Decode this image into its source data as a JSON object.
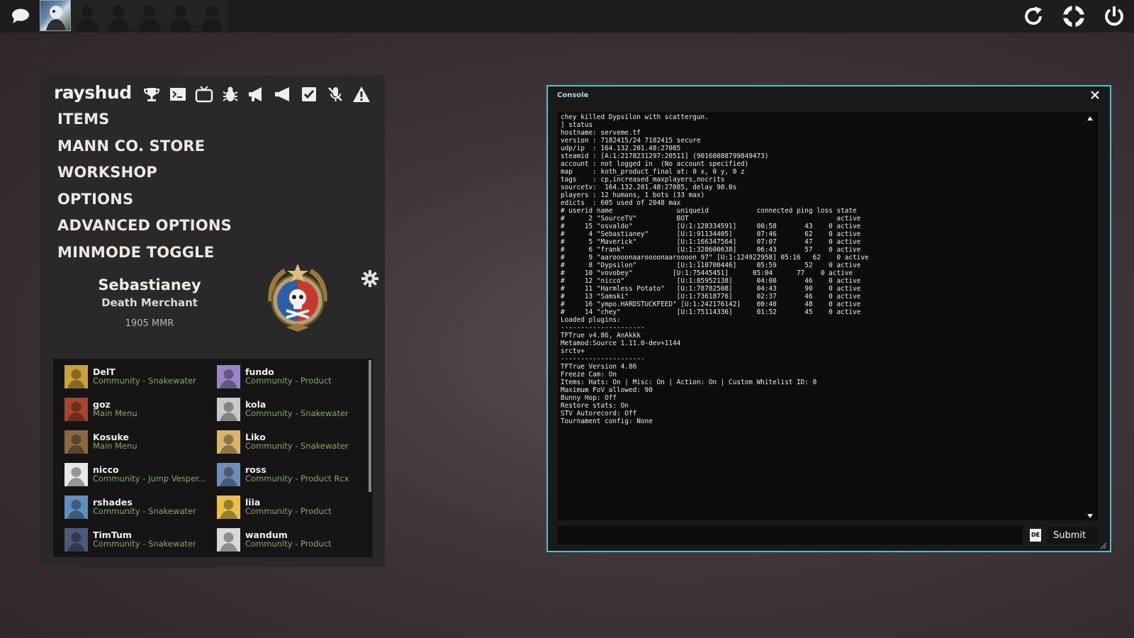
{
  "topbar": {
    "icons": {
      "chat": "chat-bubble-icon",
      "reload": "reload-icon",
      "help": "lifebuoy-icon",
      "power": "power-icon"
    },
    "party_slots": 6
  },
  "menu": {
    "brand": "rayshud",
    "quick_icons": [
      "trophy-icon",
      "terminal-icon",
      "tv-icon",
      "bug-icon",
      "megaphone-icon",
      "megaphone-alt-icon",
      "checkbox-icon",
      "mute-mic-icon",
      "warning-icon"
    ],
    "items": [
      "ITEMS",
      "MANN CO. STORE",
      "WORKSHOP",
      "OPTIONS",
      "ADVANCED OPTIONS",
      "MINMODE TOGGLE"
    ]
  },
  "player": {
    "name": "Sebastianey",
    "title": "Death Merchant",
    "mmr": "1905 MMR"
  },
  "friends": [
    {
      "name": "DelT",
      "status": "Community - Snakewater",
      "avatar_color": "#c9a23a"
    },
    {
      "name": "fundo",
      "status": "Community - Product",
      "avatar_color": "#9a86c4"
    },
    {
      "name": "goz",
      "status": "Main Menu",
      "avatar_color": "#a8462b"
    },
    {
      "name": "kola",
      "status": "Community - Snakewater",
      "avatar_color": "#c9c9c9"
    },
    {
      "name": "Kosuke",
      "status": "Main Menu",
      "avatar_color": "#8a6a45"
    },
    {
      "name": "Liko",
      "status": "Community - Snakewater",
      "avatar_color": "#d7b56a"
    },
    {
      "name": "nicco",
      "status": "Community - Jump Vesper...",
      "avatar_color": "#e8e8e8"
    },
    {
      "name": "ross",
      "status": "Community - Product Rcx",
      "avatar_color": "#6f8eb5"
    },
    {
      "name": "rshades",
      "status": "Community - Snakewater",
      "avatar_color": "#5d8fbf"
    },
    {
      "name": "liia",
      "status": "Community - Product",
      "avatar_color": "#e8c04a"
    },
    {
      "name": "TimTum",
      "status": "Community - Snakewater",
      "avatar_color": "#4a5a7a"
    },
    {
      "name": "wandum",
      "status": "Community - Product",
      "avatar_color": "#d9d9d9"
    }
  ],
  "console": {
    "title": "Console",
    "output": "chey killed Dypsilon with scattergun.\n] status\nhostname: serveme.tf\nversion : 7182415/24 7182415 secure\nudp/ip  : 164.132.201.48:27085\nsteamid : [A:1:2178231297:20511] (90160088799849473)\naccount : not logged in  (No account specified)\nmap     : koth_product_final at: 0 x, 0 y, 0 z\ntags    : cp,increased_maxplayers,nocrits\nsourcetv:  164.132.201.48:27085, delay 90.0s\nplayers : 12 humans, 1 bots (33 max)\nedicts  : 605 used of 2048 max\n# userid name                uniqueid            connected ping loss state\n#      2 \"SourceTV\"          BOT                                     active\n#     15 \"osvaldo\"           [U:1:128334591]     00:58       43    0 active\n#      4 \"Sebastianey\"       [U:1:91134405]      07:46       62    0 active\n#      5 \"Maverick\"          [U:1:166347564]     07:07       47    0 active\n#      6 \"frank\"             [U:1:328600638]     06:43       57    0 active\n#      9 \"aaroooonaaroooonaaroooon_97\" [U:1:124922958] 05:16   62    0 active\n#      8 \"Dypsilon\"          [U:1:110700446]     05:59       52    0 active\n#     10 \"vovobey\"          [U:1:75445451]      05:04      77    0 active\n#     12 \"nicco\"             [U:1:85952138]      04:00       46    0 active\n#     11 \"Harmless Potato\"   [U:1:78782508]      04:43       90    0 active\n#     13 \"Samski\"            [U:1:73618776]      02:37       46    0 active\n#     16 \"ympo.HARDSTUCKFEED\" [U:1:242176142]    00:40       48    0 active\n#     14 \"chey\"              [U:1:75114336]      01:52       45    0 active\nLoaded plugins:\n---------------------\nTFTrue v4.86, AnAkkk\nMetamod:Source 1.11.0-dev+1144\nsrctv+\n---------------------\nTFTrue Version 4.86\nFreeze Cam: On\nItems: Hats: On | Misc: On | Action: On | Custom Whitelist ID: 0\nMaximum FoV allowed: 90\nBunny Hop: Off\nRestore stats: On\nSTV Autorecord: Off\nTournament config: None",
    "input_value": "",
    "lang": "DE",
    "submit_label": "Submit",
    "accent": "#4fc1c9"
  }
}
